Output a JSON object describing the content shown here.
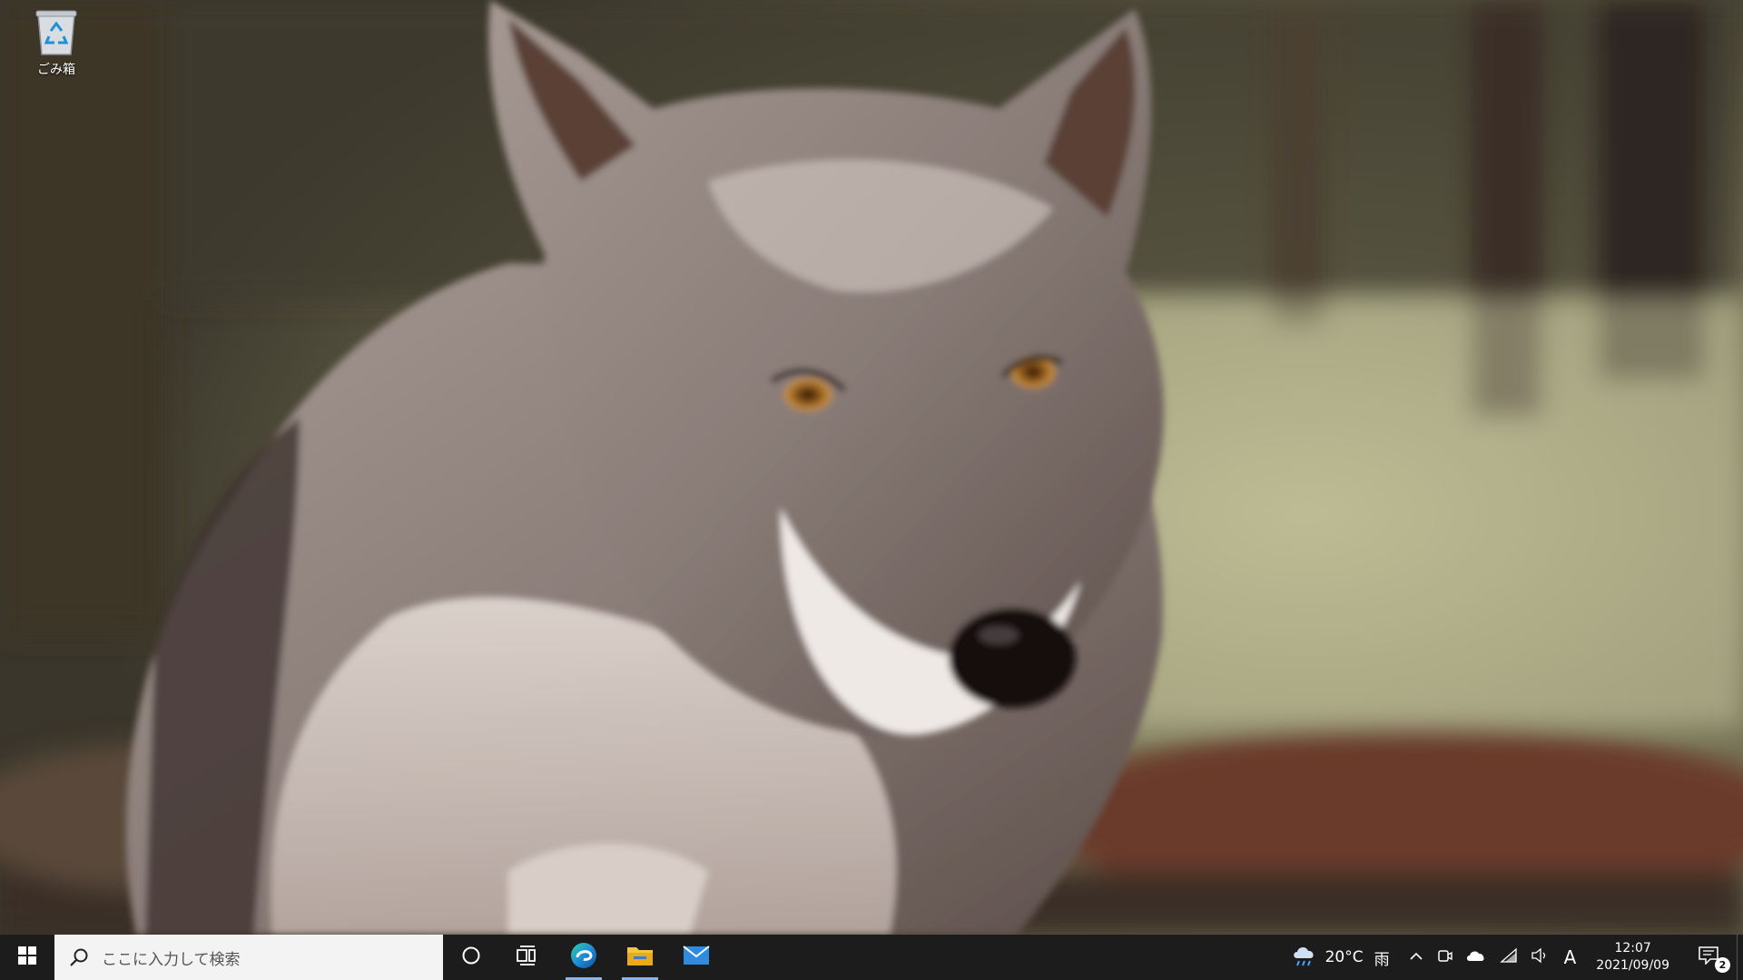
{
  "desktop": {
    "icons": [
      {
        "label": "ごみ箱",
        "icon": "recycle-bin-icon"
      }
    ]
  },
  "taskbar": {
    "start_icon": "windows-logo-icon",
    "search": {
      "placeholder": "ここに入力して検索",
      "icon": "search-icon"
    },
    "buttons": [
      {
        "name": "cortana-button",
        "icon": "circle-icon"
      },
      {
        "name": "task-view-button",
        "icon": "task-view-icon"
      },
      {
        "name": "edge-button",
        "icon": "edge-icon"
      },
      {
        "name": "file-explorer-button",
        "icon": "folder-icon"
      },
      {
        "name": "mail-button",
        "icon": "mail-icon"
      }
    ],
    "weather": {
      "icon": "rain-cloud-icon",
      "temperature": "20°C",
      "condition": "雨"
    },
    "tray": {
      "chevron_icon": "chevron-up-icon",
      "icons": [
        "meet-now-icon",
        "onedrive-cloud-icon",
        "wifi-icon",
        "volume-icon"
      ],
      "ime": "A"
    },
    "clock": {
      "time": "12:07",
      "date": "2021/09/09"
    },
    "notifications": {
      "icon": "action-center-icon",
      "count": "2"
    }
  },
  "colors": {
    "taskbar_bg": "#1c1c1c",
    "search_bg": "#f3f3f3",
    "edge_blue": "#1f8fd6",
    "folder_yellow": "#f4c542",
    "mail_blue": "#2f8be0"
  }
}
